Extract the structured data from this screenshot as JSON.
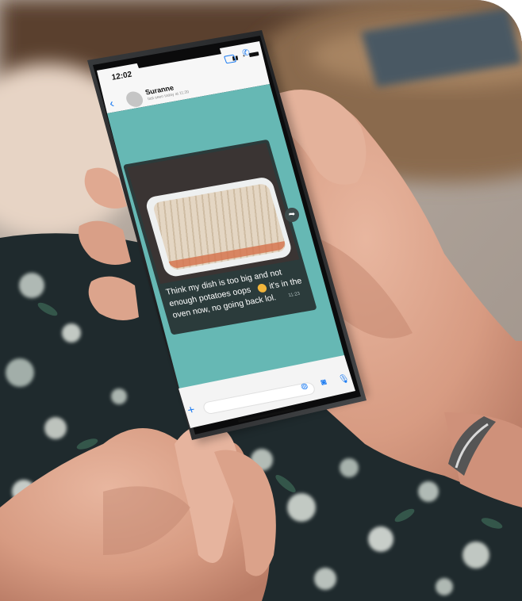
{
  "status_bar": {
    "time": "12:02"
  },
  "chat_header": {
    "contact_name": "Suranne",
    "last_seen": "last seen today at 11:20",
    "back_icon": "chevron-left-icon",
    "video_icon": "video-camera-icon",
    "call_icon": "phone-icon"
  },
  "message": {
    "caption_line1": "Think my dish is too big and not",
    "caption_line2": "enough potatoes oops",
    "caption_line2_end": "it's in the",
    "caption_line3": "oven now, no going back lol.",
    "emoji_icon": "grimacing-face-icon",
    "time": "11:23",
    "forward_icon": "share-arrow-icon"
  },
  "input_bar": {
    "add_icon": "plus-icon",
    "sticker_icon": "sticker-icon",
    "camera_icon": "camera-icon",
    "mic_icon": "microphone-icon"
  },
  "colors": {
    "chat_background": "#66b8b4",
    "bubble": "#2b3b3b",
    "header_background": "#f7f7f7",
    "accent_blue": "#1d7cf2",
    "wall": "#b1a59b",
    "shirt": "#1f2a2d"
  }
}
